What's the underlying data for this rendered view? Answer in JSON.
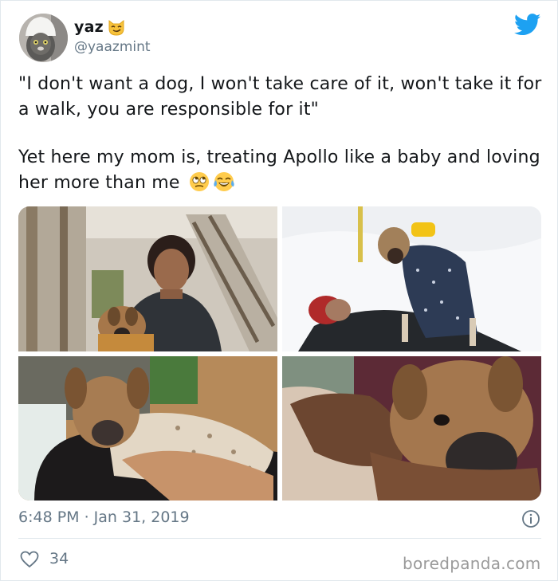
{
  "tweet": {
    "display_name": "yaz",
    "handle": "@yaazmint",
    "paragraphs": [
      "\"I don't want a dog, I won't take care of it, won't take it for a walk, you are responsible for it\"",
      "Yet here my mom is, treating Apollo like a baby and loving her more than me"
    ],
    "timestamp": "6:48 PM · Jan 31, 2019",
    "like_count": "34"
  },
  "icons": {
    "name_badge": "smirking-cat-emoji",
    "platform": "twitter-bird-icon",
    "text_emojis": [
      "rolling-eyes-emoji",
      "crying-laughing-emoji"
    ],
    "info": "info-icon",
    "like": "heart-icon"
  },
  "colors": {
    "twitter_blue": "#1da1f2",
    "secondary_text": "#657786",
    "divider": "#e1e8ed"
  },
  "photos": [
    {
      "depicts": "woman holding puppy in front of staircase"
    },
    {
      "depicts": "puppy in polka dot coat on person lying in snow"
    },
    {
      "depicts": "puppy lying on person"
    },
    {
      "depicts": "puppy held in arms close-up"
    }
  ],
  "watermark": "boredpanda.com"
}
